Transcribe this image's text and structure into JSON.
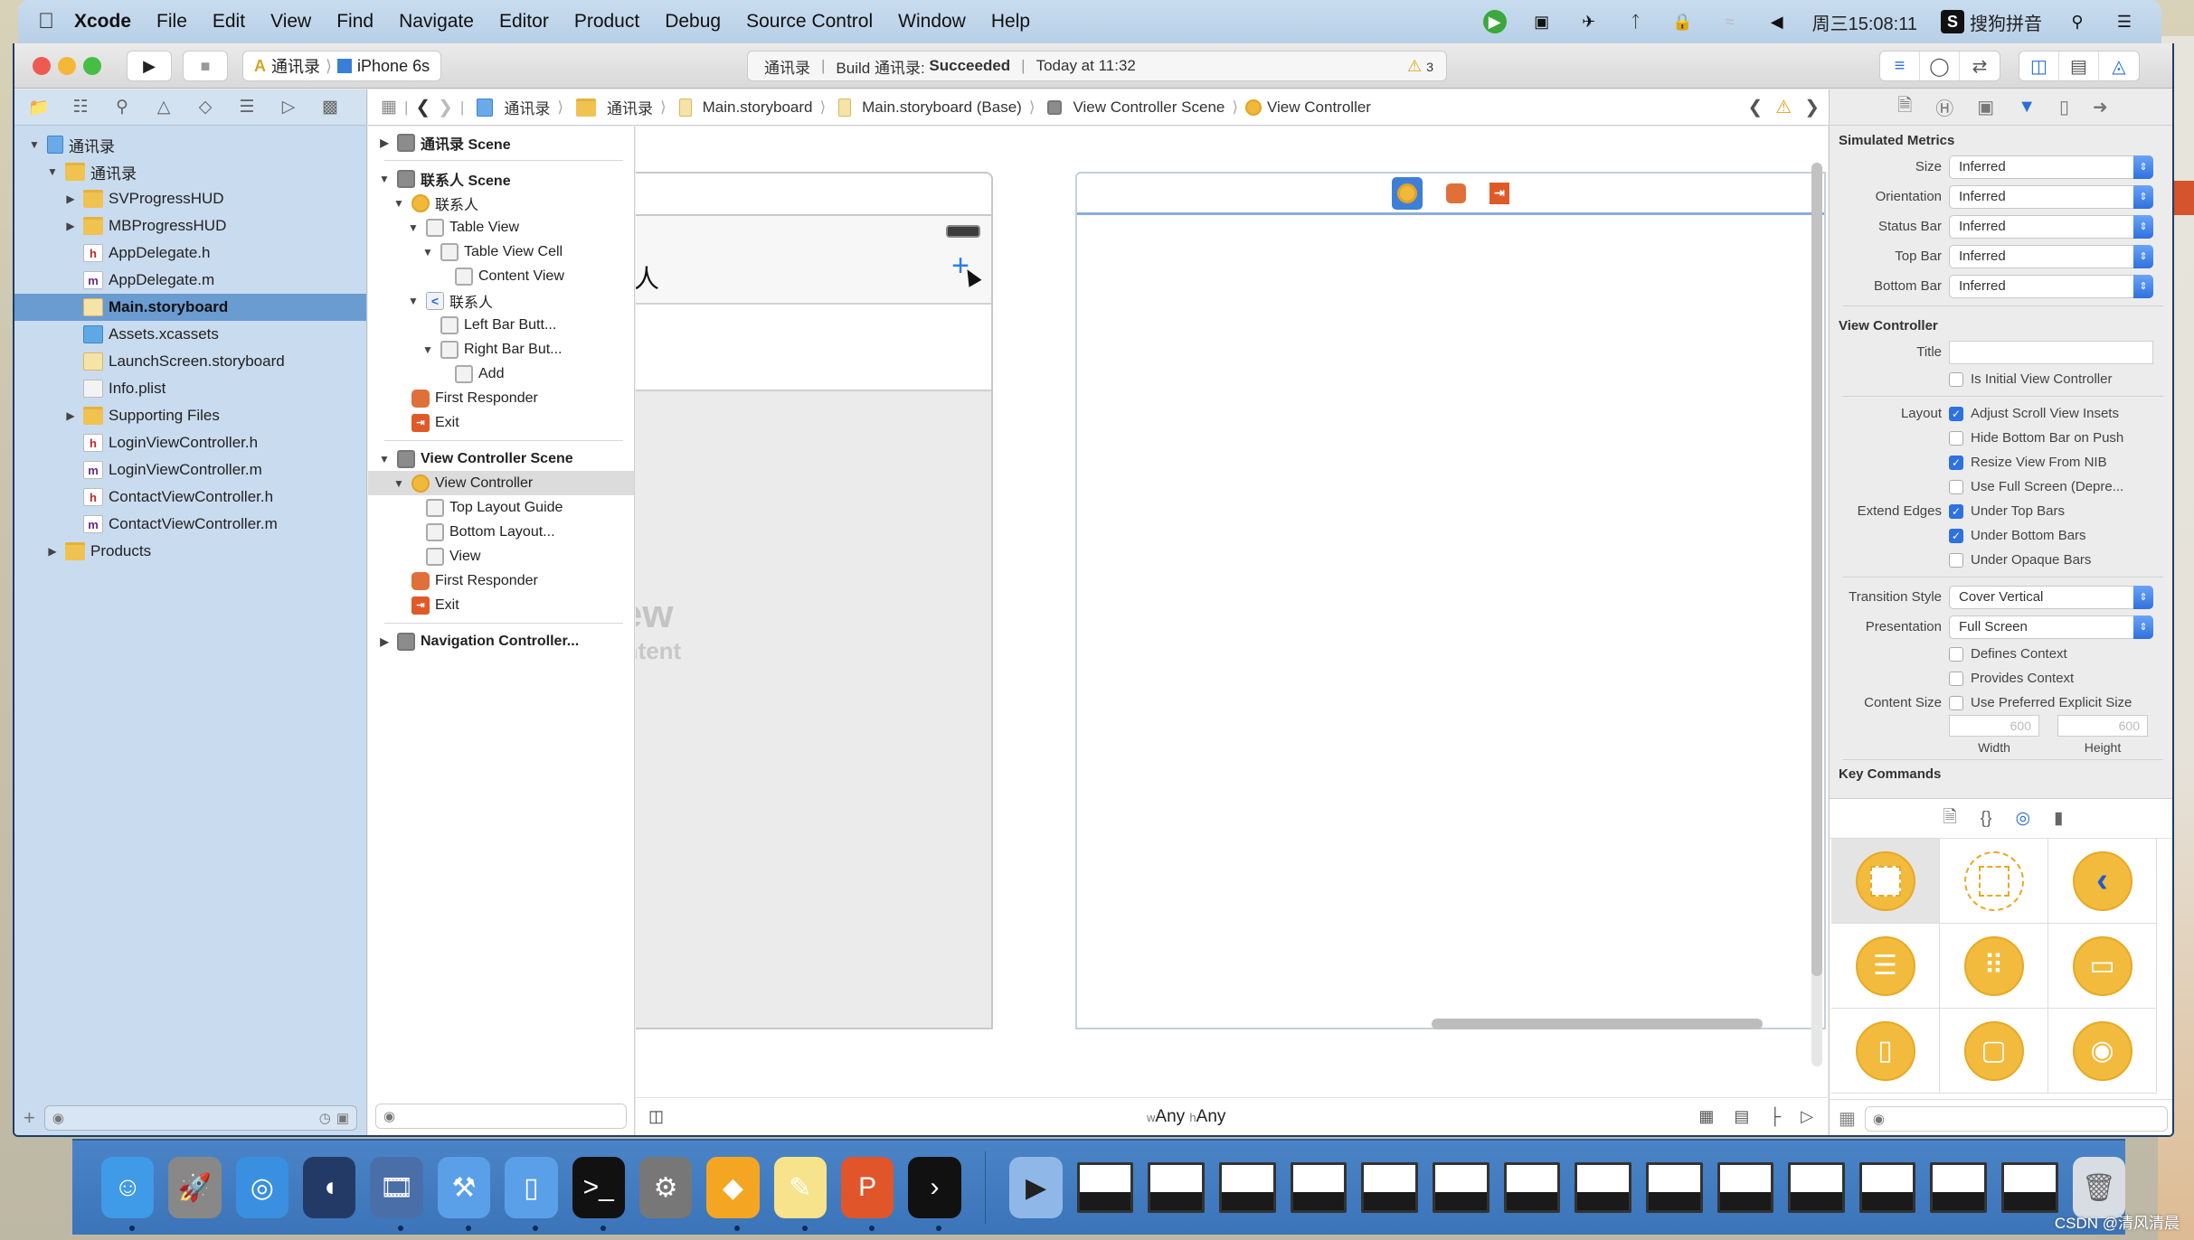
{
  "menubar": {
    "app_name": "Xcode",
    "items": [
      "File",
      "Edit",
      "View",
      "Find",
      "Navigate",
      "Editor",
      "Product",
      "Debug",
      "Source Control",
      "Window",
      "Help"
    ],
    "clock": "周三15:08:11",
    "input_method": "搜狗拼音"
  },
  "toolbar": {
    "scheme": "通讯录",
    "device": "iPhone 6s",
    "activity": {
      "project": "通讯录",
      "build_prefix": "Build 通讯录:",
      "build_status": "Succeeded",
      "time": "Today at 11:32",
      "warning_count": "3"
    }
  },
  "navigator": {
    "tabs": [
      "folder-icon",
      "hierarchy-icon",
      "search-icon",
      "warning-icon",
      "test-icon",
      "debug-icon",
      "breakpoint-icon",
      "report-icon"
    ],
    "tree": [
      {
        "label": "通讯录",
        "type": "project",
        "depth": 0,
        "disclosure": "open"
      },
      {
        "label": "通讯录",
        "type": "folder",
        "depth": 1,
        "disclosure": "open"
      },
      {
        "label": "SVProgressHUD",
        "type": "folder",
        "depth": 2,
        "disclosure": "closed"
      },
      {
        "label": "MBProgressHUD",
        "type": "folder",
        "depth": 2,
        "disclosure": "closed"
      },
      {
        "label": "AppDelegate.h",
        "type": "h",
        "depth": 2
      },
      {
        "label": "AppDelegate.m",
        "type": "m",
        "depth": 2
      },
      {
        "label": "Main.storyboard",
        "type": "storyboard",
        "depth": 2,
        "selected": true
      },
      {
        "label": "Assets.xcassets",
        "type": "asset",
        "depth": 2
      },
      {
        "label": "LaunchScreen.storyboard",
        "type": "storyboard",
        "depth": 2
      },
      {
        "label": "Info.plist",
        "type": "plist",
        "depth": 2
      },
      {
        "label": "Supporting Files",
        "type": "folder",
        "depth": 2,
        "disclosure": "closed"
      },
      {
        "label": "LoginViewController.h",
        "type": "h",
        "depth": 2
      },
      {
        "label": "LoginViewController.m",
        "type": "m",
        "depth": 2
      },
      {
        "label": "ContactViewController.h",
        "type": "h",
        "depth": 2
      },
      {
        "label": "ContactViewController.m",
        "type": "m",
        "depth": 2
      },
      {
        "label": "Products",
        "type": "folder",
        "depth": 1,
        "disclosure": "closed"
      }
    ]
  },
  "jumpbar": {
    "crumbs": [
      "通讯录",
      "通讯录",
      "Main.storyboard",
      "Main.storyboard (Base)",
      "View Controller Scene",
      "View Controller"
    ]
  },
  "outline": {
    "rows": [
      {
        "label": "通讯录 Scene",
        "icon": "scene",
        "depth": 0,
        "disclosure": "closed",
        "bold": true
      },
      {
        "sep": true
      },
      {
        "label": "联系人 Scene",
        "icon": "scene",
        "depth": 0,
        "disclosure": "open",
        "bold": true
      },
      {
        "label": "联系人",
        "icon": "vc",
        "depth": 1,
        "disclosure": "open"
      },
      {
        "label": "Table View",
        "icon": "box",
        "depth": 2,
        "disclosure": "open"
      },
      {
        "label": "Table View Cell",
        "icon": "box",
        "depth": 3,
        "disclosure": "open"
      },
      {
        "label": "Content View",
        "icon": "box",
        "depth": 4
      },
      {
        "label": "联系人",
        "icon": "nav",
        "depth": 2,
        "disclosure": "open"
      },
      {
        "label": "Left Bar Butt...",
        "icon": "box",
        "depth": 3
      },
      {
        "label": "Right Bar But...",
        "icon": "box",
        "depth": 3,
        "disclosure": "open"
      },
      {
        "label": "Add",
        "icon": "box",
        "depth": 4
      },
      {
        "label": "First Responder",
        "icon": "fr",
        "depth": 1
      },
      {
        "label": "Exit",
        "icon": "exit",
        "depth": 1
      },
      {
        "sep": true
      },
      {
        "label": "View Controller Scene",
        "icon": "scene",
        "depth": 0,
        "disclosure": "open",
        "bold": true
      },
      {
        "label": "View Controller",
        "icon": "vc",
        "depth": 1,
        "disclosure": "open",
        "selected": true
      },
      {
        "label": "Top Layout Guide",
        "icon": "box",
        "depth": 2
      },
      {
        "label": "Bottom Layout...",
        "icon": "box",
        "depth": 2
      },
      {
        "label": "View",
        "icon": "box",
        "depth": 2
      },
      {
        "label": "First Responder",
        "icon": "fr",
        "depth": 1
      },
      {
        "label": "Exit",
        "icon": "exit",
        "depth": 1
      },
      {
        "sep": true
      },
      {
        "label": "Navigation Controller...",
        "icon": "scene",
        "depth": 0,
        "disclosure": "closed",
        "bold": true
      }
    ]
  },
  "canvas": {
    "scene1": {
      "nav_title_fragment": "人",
      "add_button": "+",
      "placeholder_title": "View",
      "placeholder_sub": "Content"
    },
    "size_class": {
      "w_prefix": "w",
      "w": "Any",
      "h_prefix": "h",
      "h": "Any"
    }
  },
  "inspector": {
    "tabs": [
      "file-icon",
      "help-icon",
      "identity-icon",
      "attributes-icon",
      "size-icon",
      "connections-icon"
    ],
    "simulated_metrics": {
      "title": "Simulated Metrics",
      "rows": [
        {
          "label": "Size",
          "value": "Inferred"
        },
        {
          "label": "Orientation",
          "value": "Inferred"
        },
        {
          "label": "Status Bar",
          "value": "Inferred"
        },
        {
          "label": "Top Bar",
          "value": "Inferred"
        },
        {
          "label": "Bottom Bar",
          "value": "Inferred"
        }
      ]
    },
    "view_controller": {
      "title": "View Controller",
      "title_label": "Title",
      "title_value": "",
      "is_initial": {
        "label": "Is Initial View Controller",
        "checked": false
      },
      "layout_label": "Layout",
      "layout": [
        {
          "label": "Adjust Scroll View Insets",
          "checked": true
        },
        {
          "label": "Hide Bottom Bar on Push",
          "checked": false
        },
        {
          "label": "Resize View From NIB",
          "checked": true
        },
        {
          "label": "Use Full Screen (Depre...",
          "checked": false
        }
      ],
      "extend_edges_label": "Extend Edges",
      "extend_edges": [
        {
          "label": "Under Top Bars",
          "checked": true
        },
        {
          "label": "Under Bottom Bars",
          "checked": true
        },
        {
          "label": "Under Opaque Bars",
          "checked": false
        }
      ],
      "transition_style": {
        "label": "Transition Style",
        "value": "Cover Vertical"
      },
      "presentation": {
        "label": "Presentation",
        "value": "Full Screen"
      },
      "context": [
        {
          "label": "Defines Context",
          "checked": false
        },
        {
          "label": "Provides Context",
          "checked": false
        }
      ],
      "content_size_label": "Content Size",
      "content_size": {
        "label": "Use Preferred Explicit Size",
        "checked": false
      },
      "width": {
        "value": "600",
        "label": "Width"
      },
      "height": {
        "value": "600",
        "label": "Height"
      },
      "key_commands": "Key Commands"
    },
    "library_tabs": [
      "file-template-icon",
      "code-snippet-icon",
      "object-library-icon",
      "media-library-icon"
    ],
    "library_items": [
      "view-controller",
      "storyboard-reference",
      "navigation-controller",
      "table-view-controller",
      "collection-view-controller",
      "tab-bar-controller",
      "split-view-controller",
      "page-view-controller",
      "glkit-view-controller"
    ]
  },
  "dock": {
    "apps": [
      "Finder",
      "Launchpad",
      "Safari",
      "Mouse",
      "Photo Booth",
      "Xcode",
      "Simulator",
      "Terminal",
      "System Preferences",
      "Sketch",
      "Notes",
      "Keynote",
      "Console"
    ],
    "minimized_windows": 14
  },
  "watermark": "CSDN @清风清晨"
}
